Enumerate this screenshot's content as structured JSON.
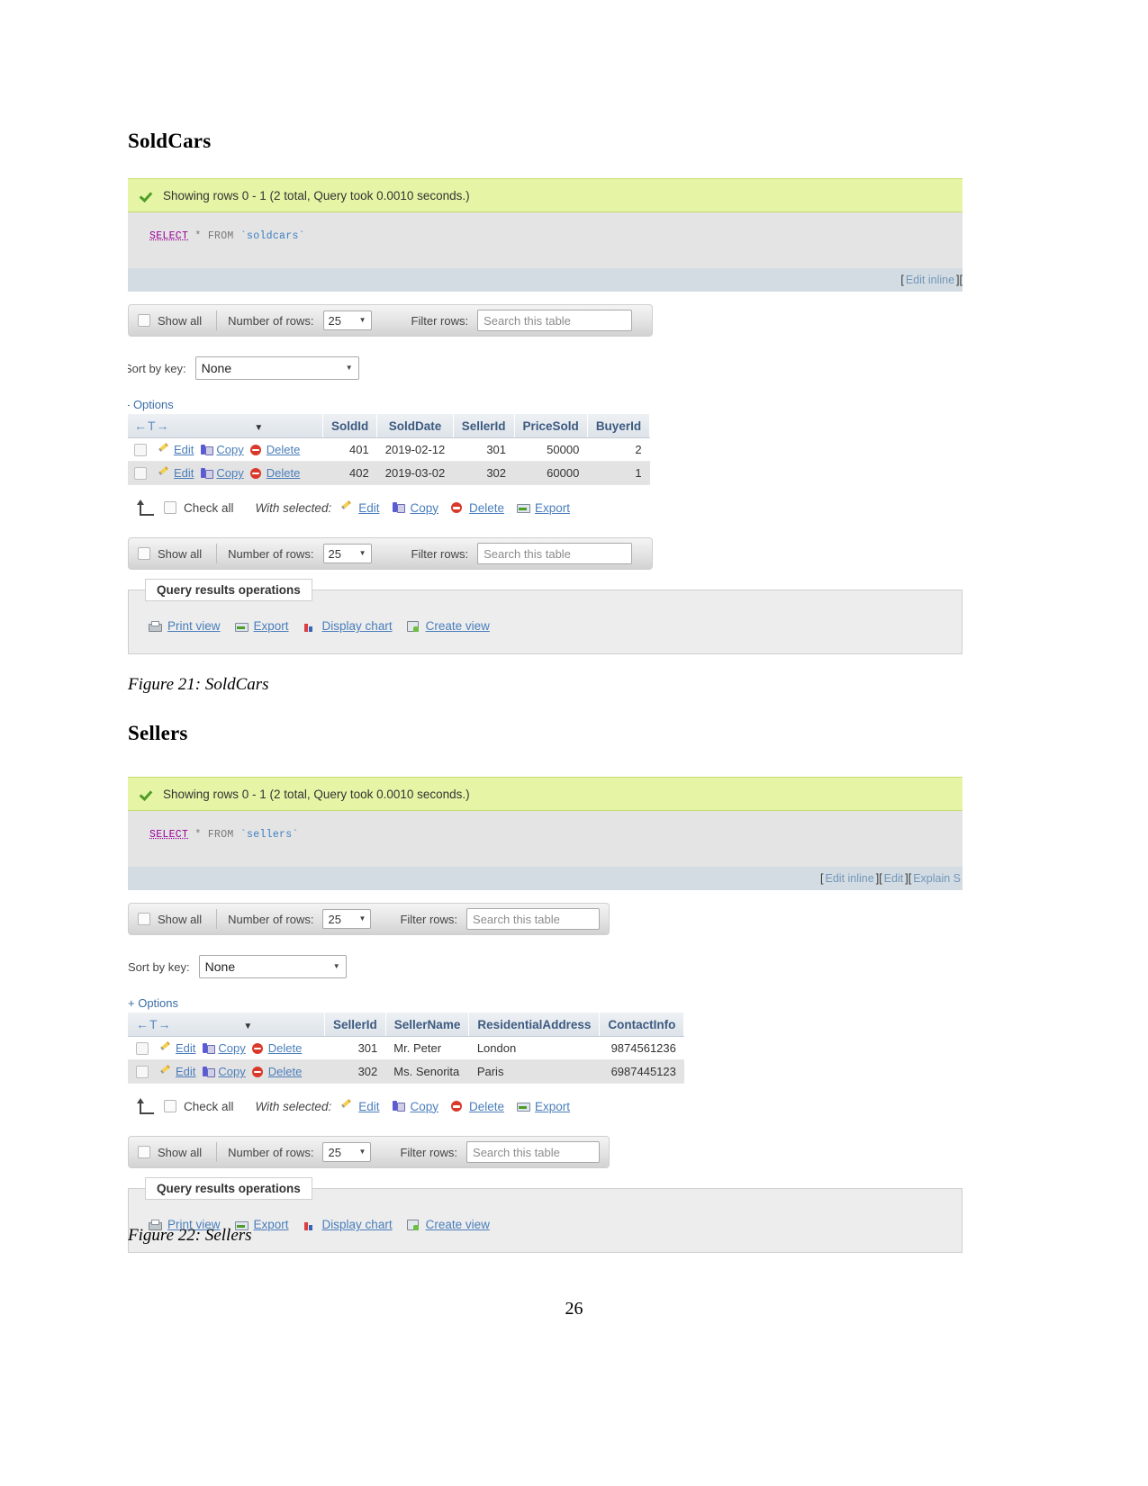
{
  "document": {
    "page_number": "26",
    "sections": [
      {
        "heading": "SoldCars",
        "caption": "Figure 21: SoldCars"
      },
      {
        "heading": "Sellers",
        "caption": "Figure 22: Sellers"
      }
    ]
  },
  "soldcars_panel": {
    "status_message": "Showing rows 0 - 1 (2 total, Query took 0.0010 seconds.)",
    "sql": {
      "keyword": "SELECT",
      "star": "*",
      "from": "FROM",
      "table": "`soldcars`"
    },
    "links": {
      "open_bracket": "[",
      "edit_inline": "Edit inline",
      "close_bracket": "]",
      "trailing": "["
    },
    "controls": {
      "show_all_label": "Show all",
      "number_of_rows_label": "Number of rows:",
      "number_of_rows_value": "25",
      "filter_rows_label": "Filter rows:",
      "filter_placeholder": "Search this table"
    },
    "sort": {
      "label": "Sort by key:",
      "value": "None"
    },
    "options_link": "- Options",
    "table": {
      "actions_header": "←T→",
      "columns": [
        "SoldId",
        "SoldDate",
        "SellerId",
        "PriceSold",
        "BuyerId"
      ],
      "row_actions": [
        "Edit",
        "Copy",
        "Delete"
      ],
      "rows": [
        {
          "SoldId": "401",
          "SoldDate": "2019-02-12",
          "SellerId": "301",
          "PriceSold": "50000",
          "BuyerId": "2"
        },
        {
          "SoldId": "402",
          "SoldDate": "2019-03-02",
          "SellerId": "302",
          "PriceSold": "60000",
          "BuyerId": "1"
        }
      ]
    },
    "footer_actions": {
      "check_all": "Check all",
      "with_selected": "With selected:",
      "edit": "Edit",
      "copy": "Copy",
      "delete": "Delete",
      "export": "Export"
    },
    "query_results_operations": {
      "legend": "Query results operations",
      "print_view": "Print view",
      "export": "Export",
      "display_chart": "Display chart",
      "create_view": "Create view"
    }
  },
  "sellers_panel": {
    "status_message": "Showing rows 0 - 1 (2 total, Query took 0.0010 seconds.)",
    "sql": {
      "keyword": "SELECT",
      "star": "*",
      "from": "FROM",
      "table": "`sellers`"
    },
    "links": {
      "open_bracket": "[",
      "edit_inline": "Edit inline",
      "close_bracket": "]",
      "edit": "Edit",
      "explain": "Explain S"
    },
    "controls": {
      "show_all_label": "Show all",
      "number_of_rows_label": "Number of rows:",
      "number_of_rows_value": "25",
      "filter_rows_label": "Filter rows:",
      "filter_placeholder": "Search this table"
    },
    "sort": {
      "label": "Sort by key:",
      "value": "None"
    },
    "options_link": "+ Options",
    "table": {
      "actions_header": "←T→",
      "columns": [
        "SellerId",
        "SellerName",
        "ResidentialAddress",
        "ContactInfo"
      ],
      "row_actions": [
        "Edit",
        "Copy",
        "Delete"
      ],
      "rows": [
        {
          "SellerId": "301",
          "SellerName": "Mr. Peter",
          "ResidentialAddress": "London",
          "ContactInfo": "9874561236"
        },
        {
          "SellerId": "302",
          "SellerName": "Ms. Senorita",
          "ResidentialAddress": "Paris",
          "ContactInfo": "6987445123"
        }
      ]
    },
    "footer_actions": {
      "check_all": "Check all",
      "with_selected": "With selected:",
      "edit": "Edit",
      "copy": "Copy",
      "delete": "Delete",
      "export": "Export"
    },
    "query_results_operations": {
      "legend": "Query results operations",
      "print_view": "Print view",
      "export": "Export",
      "display_chart": "Display chart",
      "create_view": "Create view"
    }
  }
}
